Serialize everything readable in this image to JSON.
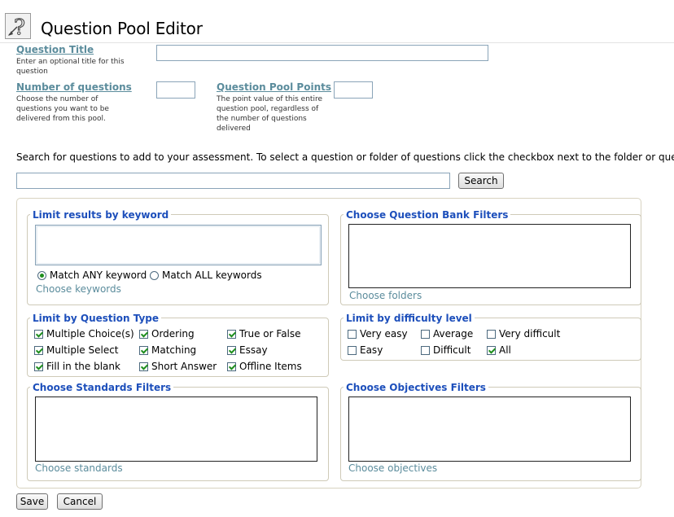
{
  "header": {
    "title": "Question Pool Editor",
    "icon": "question-pool-icon"
  },
  "form": {
    "question_title": {
      "label": "Question Title",
      "help": "Enter an optional title for this question",
      "value": ""
    },
    "num_questions": {
      "label": "Number of questions",
      "help": "Choose the number of questions you want to be delivered from this pool.",
      "value": ""
    },
    "pool_points": {
      "label": "Question Pool Points",
      "help": "The point value of this entire question pool, regardless of the number of questions delivered",
      "value": ""
    }
  },
  "search": {
    "instructions": "Search for questions to add to your assessment. To select a question or folder of questions click the checkbox next to the folder or question.",
    "value": "",
    "button": "Search"
  },
  "keyword": {
    "legend": "Limit results by keyword",
    "match_any": "Match ANY keyword",
    "match_all": "Match ALL keywords",
    "selected": "any",
    "link": "Choose keywords"
  },
  "bank": {
    "legend": "Choose Question Bank Filters",
    "link": "Choose folders"
  },
  "qtype": {
    "legend": "Limit by Question Type",
    "items": [
      {
        "label": "Multiple Choice(s)",
        "checked": true
      },
      {
        "label": "Ordering",
        "checked": true
      },
      {
        "label": "True or False",
        "checked": true
      },
      {
        "label": "Multiple Select",
        "checked": true
      },
      {
        "label": "Matching",
        "checked": true
      },
      {
        "label": "Essay",
        "checked": true
      },
      {
        "label": "Fill in the blank",
        "checked": true
      },
      {
        "label": "Short Answer",
        "checked": true
      },
      {
        "label": "Offline Items",
        "checked": true
      }
    ]
  },
  "difficulty": {
    "legend": "Limit by difficulty level",
    "items": [
      {
        "label": "Very easy",
        "checked": false
      },
      {
        "label": "Average",
        "checked": false
      },
      {
        "label": "Very difficult",
        "checked": false
      },
      {
        "label": "Easy",
        "checked": false
      },
      {
        "label": "Difficult",
        "checked": false
      },
      {
        "label": "All",
        "checked": true
      }
    ]
  },
  "standards": {
    "legend": "Choose Standards Filters",
    "link": "Choose standards"
  },
  "objectives": {
    "legend": "Choose Objectives Filters",
    "link": "Choose objectives"
  },
  "footer": {
    "save": "Save",
    "cancel": "Cancel"
  },
  "colors": {
    "legend": "#1d4fbb",
    "label_link": "#5b8c9c",
    "check": "#1f8f1f"
  }
}
